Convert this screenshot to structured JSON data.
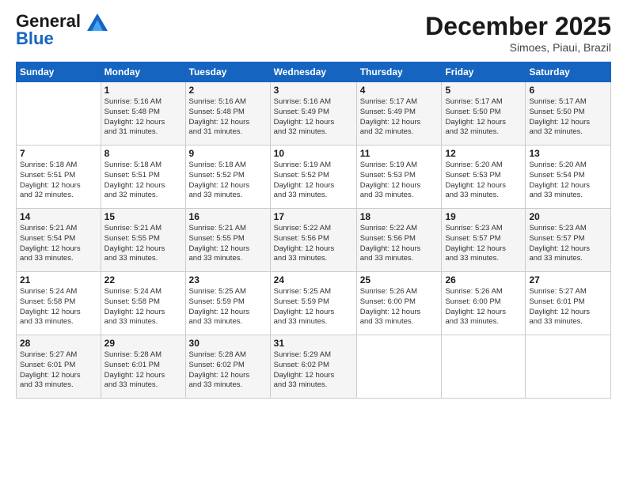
{
  "header": {
    "logo_line1": "General",
    "logo_line2": "Blue",
    "month": "December 2025",
    "location": "Simoes, Piaui, Brazil"
  },
  "weekdays": [
    "Sunday",
    "Monday",
    "Tuesday",
    "Wednesday",
    "Thursday",
    "Friday",
    "Saturday"
  ],
  "weeks": [
    [
      {
        "day": "",
        "info": ""
      },
      {
        "day": "1",
        "info": "Sunrise: 5:16 AM\nSunset: 5:48 PM\nDaylight: 12 hours\nand 31 minutes."
      },
      {
        "day": "2",
        "info": "Sunrise: 5:16 AM\nSunset: 5:48 PM\nDaylight: 12 hours\nand 31 minutes."
      },
      {
        "day": "3",
        "info": "Sunrise: 5:16 AM\nSunset: 5:49 PM\nDaylight: 12 hours\nand 32 minutes."
      },
      {
        "day": "4",
        "info": "Sunrise: 5:17 AM\nSunset: 5:49 PM\nDaylight: 12 hours\nand 32 minutes."
      },
      {
        "day": "5",
        "info": "Sunrise: 5:17 AM\nSunset: 5:50 PM\nDaylight: 12 hours\nand 32 minutes."
      },
      {
        "day": "6",
        "info": "Sunrise: 5:17 AM\nSunset: 5:50 PM\nDaylight: 12 hours\nand 32 minutes."
      }
    ],
    [
      {
        "day": "7",
        "info": "Sunrise: 5:18 AM\nSunset: 5:51 PM\nDaylight: 12 hours\nand 32 minutes."
      },
      {
        "day": "8",
        "info": "Sunrise: 5:18 AM\nSunset: 5:51 PM\nDaylight: 12 hours\nand 32 minutes."
      },
      {
        "day": "9",
        "info": "Sunrise: 5:18 AM\nSunset: 5:52 PM\nDaylight: 12 hours\nand 33 minutes."
      },
      {
        "day": "10",
        "info": "Sunrise: 5:19 AM\nSunset: 5:52 PM\nDaylight: 12 hours\nand 33 minutes."
      },
      {
        "day": "11",
        "info": "Sunrise: 5:19 AM\nSunset: 5:53 PM\nDaylight: 12 hours\nand 33 minutes."
      },
      {
        "day": "12",
        "info": "Sunrise: 5:20 AM\nSunset: 5:53 PM\nDaylight: 12 hours\nand 33 minutes."
      },
      {
        "day": "13",
        "info": "Sunrise: 5:20 AM\nSunset: 5:54 PM\nDaylight: 12 hours\nand 33 minutes."
      }
    ],
    [
      {
        "day": "14",
        "info": "Sunrise: 5:21 AM\nSunset: 5:54 PM\nDaylight: 12 hours\nand 33 minutes."
      },
      {
        "day": "15",
        "info": "Sunrise: 5:21 AM\nSunset: 5:55 PM\nDaylight: 12 hours\nand 33 minutes."
      },
      {
        "day": "16",
        "info": "Sunrise: 5:21 AM\nSunset: 5:55 PM\nDaylight: 12 hours\nand 33 minutes."
      },
      {
        "day": "17",
        "info": "Sunrise: 5:22 AM\nSunset: 5:56 PM\nDaylight: 12 hours\nand 33 minutes."
      },
      {
        "day": "18",
        "info": "Sunrise: 5:22 AM\nSunset: 5:56 PM\nDaylight: 12 hours\nand 33 minutes."
      },
      {
        "day": "19",
        "info": "Sunrise: 5:23 AM\nSunset: 5:57 PM\nDaylight: 12 hours\nand 33 minutes."
      },
      {
        "day": "20",
        "info": "Sunrise: 5:23 AM\nSunset: 5:57 PM\nDaylight: 12 hours\nand 33 minutes."
      }
    ],
    [
      {
        "day": "21",
        "info": "Sunrise: 5:24 AM\nSunset: 5:58 PM\nDaylight: 12 hours\nand 33 minutes."
      },
      {
        "day": "22",
        "info": "Sunrise: 5:24 AM\nSunset: 5:58 PM\nDaylight: 12 hours\nand 33 minutes."
      },
      {
        "day": "23",
        "info": "Sunrise: 5:25 AM\nSunset: 5:59 PM\nDaylight: 12 hours\nand 33 minutes."
      },
      {
        "day": "24",
        "info": "Sunrise: 5:25 AM\nSunset: 5:59 PM\nDaylight: 12 hours\nand 33 minutes."
      },
      {
        "day": "25",
        "info": "Sunrise: 5:26 AM\nSunset: 6:00 PM\nDaylight: 12 hours\nand 33 minutes."
      },
      {
        "day": "26",
        "info": "Sunrise: 5:26 AM\nSunset: 6:00 PM\nDaylight: 12 hours\nand 33 minutes."
      },
      {
        "day": "27",
        "info": "Sunrise: 5:27 AM\nSunset: 6:01 PM\nDaylight: 12 hours\nand 33 minutes."
      }
    ],
    [
      {
        "day": "28",
        "info": "Sunrise: 5:27 AM\nSunset: 6:01 PM\nDaylight: 12 hours\nand 33 minutes."
      },
      {
        "day": "29",
        "info": "Sunrise: 5:28 AM\nSunset: 6:01 PM\nDaylight: 12 hours\nand 33 minutes."
      },
      {
        "day": "30",
        "info": "Sunrise: 5:28 AM\nSunset: 6:02 PM\nDaylight: 12 hours\nand 33 minutes."
      },
      {
        "day": "31",
        "info": "Sunrise: 5:29 AM\nSunset: 6:02 PM\nDaylight: 12 hours\nand 33 minutes."
      },
      {
        "day": "",
        "info": ""
      },
      {
        "day": "",
        "info": ""
      },
      {
        "day": "",
        "info": ""
      }
    ]
  ]
}
